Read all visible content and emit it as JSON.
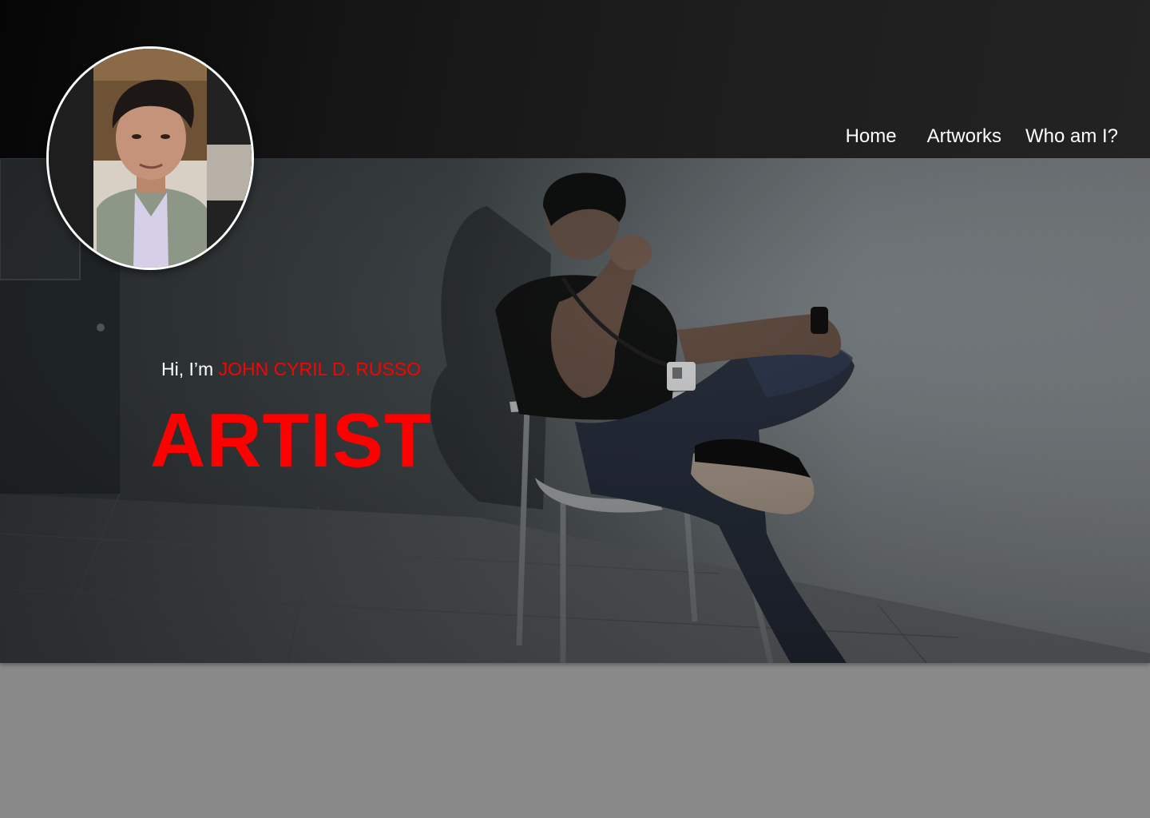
{
  "header": {
    "nav": [
      {
        "label": "Home"
      },
      {
        "label": "Artworks"
      },
      {
        "label": "Who am I?"
      }
    ]
  },
  "hero": {
    "greeting_prefix": "Hi, I’m ",
    "name": "JOHN CYRIL D. RUSSO",
    "role": "ARTIST"
  },
  "colors": {
    "accent": "#ff0000",
    "header_bg": "#1d1d1d",
    "page_bg": "#898989",
    "nav_text": "#ffffff"
  }
}
